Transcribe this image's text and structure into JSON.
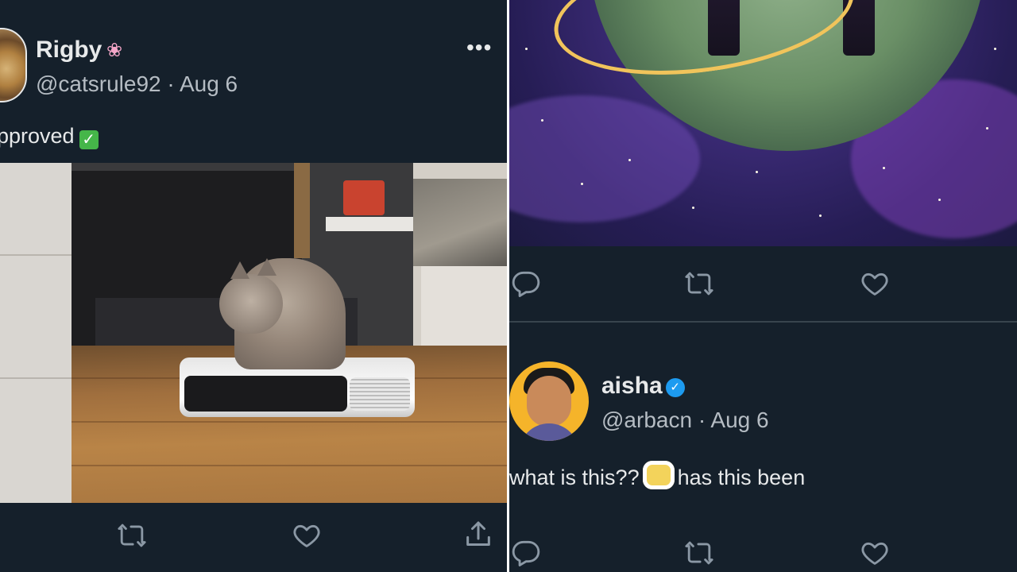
{
  "left_tweet": {
    "name": "Rigby",
    "handle": "@catsrule92",
    "separator": "·",
    "date": "Aug 6",
    "text": "pproved",
    "name_emoji": "flower-icon",
    "text_emoji": "check-mark-icon",
    "more_label": "•••"
  },
  "right_top_actions": [
    "reply-icon",
    "retweet-icon",
    "like-icon"
  ],
  "right_tweet": {
    "name": "aisha",
    "handle": "@arbacn",
    "separator": "·",
    "date": "Aug 6",
    "text_before": "what is this??",
    "text_after": "has this been",
    "verified": true
  },
  "colors": {
    "background": "#15202b",
    "text": "#e7e9ea",
    "secondary": "#8b98a5",
    "verified": "#1d9bf0",
    "divider": "#38444d"
  }
}
